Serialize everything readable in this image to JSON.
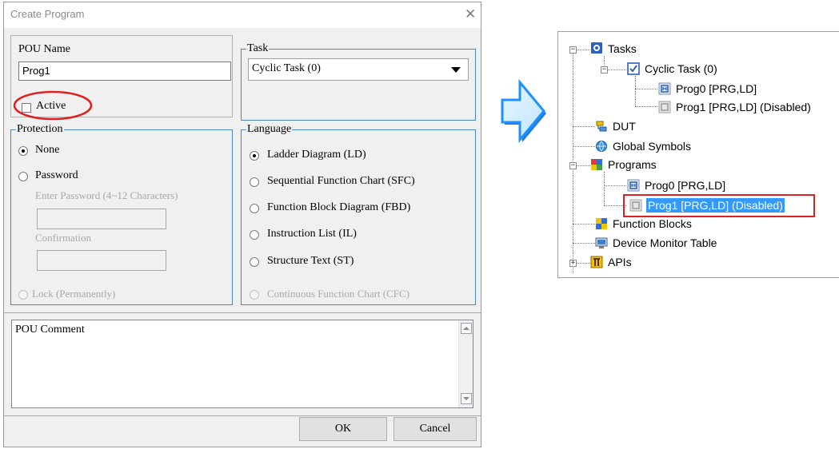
{
  "dialog": {
    "title": "Create Program",
    "close_glyph": "✕",
    "pou_name_label": "POU Name",
    "pou_name_value": "Prog1",
    "active_label": "Active",
    "task": {
      "label": "Task",
      "selected": "Cyclic Task (0)"
    },
    "protection": {
      "label": "Protection",
      "options": [
        "None",
        "Password"
      ],
      "password_label": "Enter Password (4~12 Characters)",
      "confirmation_label": "Confirmation",
      "lock_label": "Lock (Permanently)"
    },
    "language": {
      "label": "Language",
      "options": [
        "Ladder Diagram (LD)",
        "Sequential Function Chart (SFC)",
        "Function Block Diagram (FBD)",
        "Instruction List (IL)",
        "Structure Text (ST)",
        "Continuous Function Chart (CFC)"
      ]
    },
    "comment_label": "POU Comment",
    "ok_label": "OK",
    "cancel_label": "Cancel"
  },
  "tree": {
    "tasks": "Tasks",
    "cyclic_task": "Cyclic Task (0)",
    "task_prog0": "Prog0 [PRG,LD]",
    "task_prog1": "Prog1 [PRG,LD] (Disabled)",
    "dut": "DUT",
    "global_symbols": "Global Symbols",
    "programs": "Programs",
    "prog0": "Prog0 [PRG,LD]",
    "prog1": "Prog1 [PRG,LD] (Disabled)",
    "function_blocks": "Function Blocks",
    "device_monitor_table": "Device Monitor Table",
    "apis": "APIs"
  },
  "colors": {
    "group_border": "#4d86c6",
    "highlight_red": "#e02020",
    "selection_blue": "#3399ff",
    "arrow_fill": "#1e90ff"
  }
}
